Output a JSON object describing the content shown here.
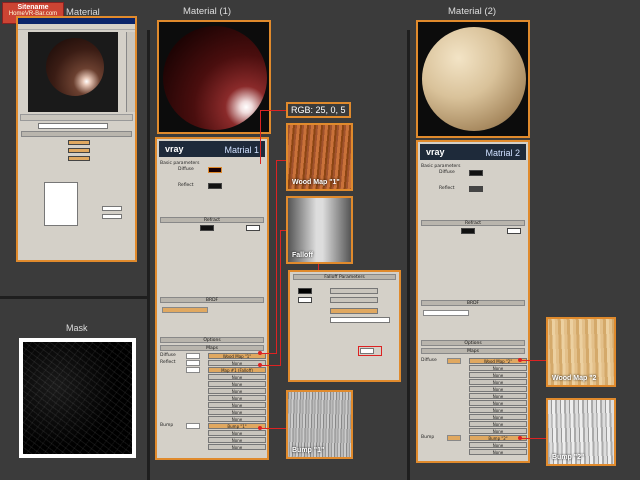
{
  "titles": {
    "original": "Material",
    "material1": "Material (1)",
    "material2": "Material (2)",
    "mask": "Mask"
  },
  "watermark": {
    "line1": "Sitename",
    "line2": "HomeVR-Bar.com"
  },
  "rgb_label": "RGB: 25, 0, 5",
  "panel1": {
    "vray_logo": "vray",
    "name": "Matrial 1"
  },
  "panel2": {
    "vray_logo": "vray",
    "name": "Matrial 2"
  },
  "thumbs": {
    "wood1": "Wood Map \"1\"",
    "falloff": "Falloff",
    "bump1": "Bump \"1\"",
    "wood2": "Wood Map \"2",
    "bump2": "Bump \"2\""
  },
  "rows": {
    "diffuse": "Diffuse",
    "reflect": "Reflect",
    "refract": "Refract",
    "bump": "Bump",
    "maps": "Maps",
    "none": "None",
    "wood_map_1": "Wood Map \"1\"",
    "map_falloff": "Map #1 (Falloff)",
    "bump_1": "Bump \"1\"",
    "wood_map_2": "Wood Map \"2\"",
    "bump_2": "Bump \"2\"",
    "falloff_params": "Falloff Parameters",
    "basic": "Basic parameters",
    "brdf": "BRDF",
    "options": "Options"
  },
  "colors": {
    "accent": "#e08a2c",
    "link": "#dd2222",
    "vray_header": "#1e2a3a"
  }
}
